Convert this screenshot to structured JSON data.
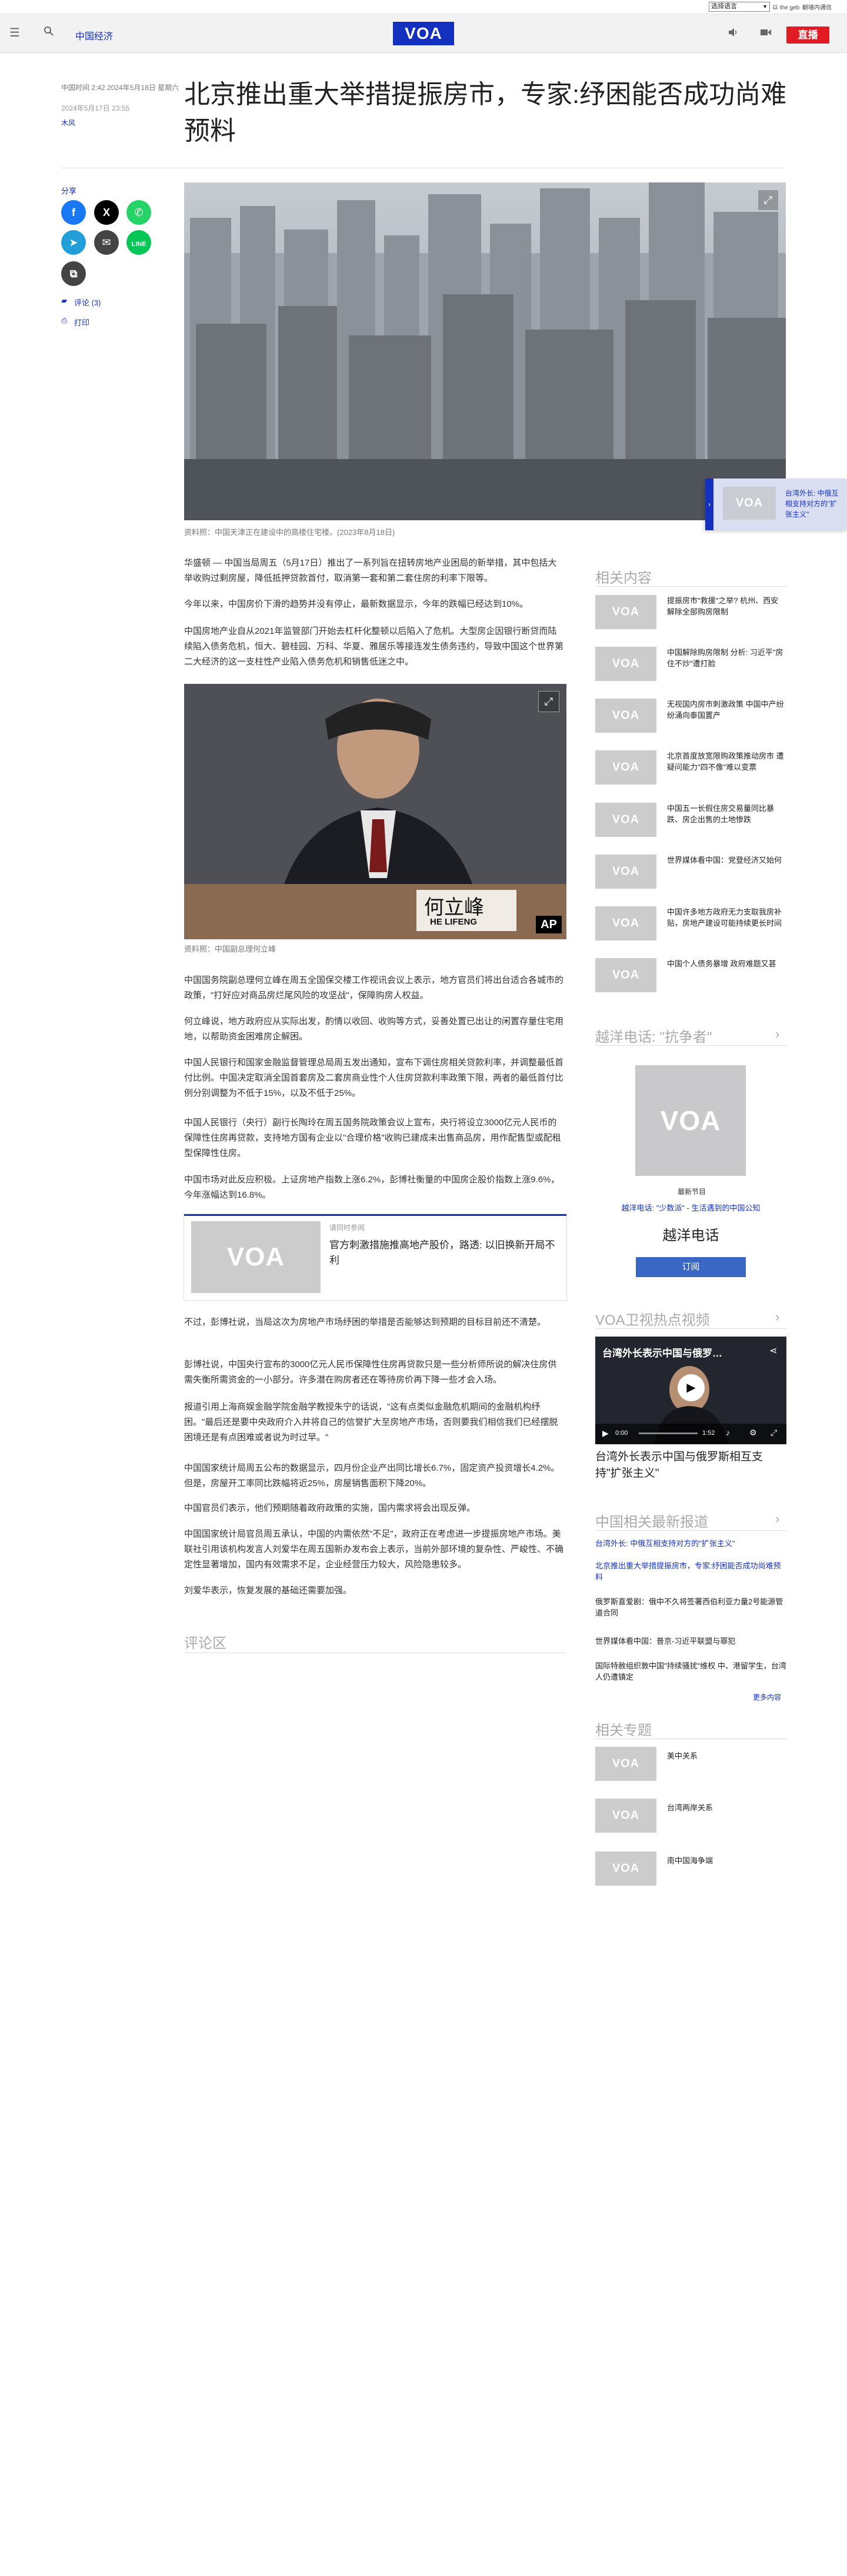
{
  "utility": {
    "lang_select": "选择语言",
    "link1": "以 the geb",
    "link2": "翻墙内通信"
  },
  "header": {
    "section": "中国经济",
    "logo": "VOA",
    "live": "直播"
  },
  "article": {
    "dateline": "中国时间 2:42 2024年5月18日 星期六",
    "pubdate": "2024年5月17日 23:55",
    "author": "木风",
    "title": "北京推出重大举措提振房市，专家:纾困能否成功尚难预料",
    "hero_caption": "资料照：中国天津正在建设中的高楼住宅楼。(2023年8月18日)",
    "photo2_caption": "资料照：中国副总理何立峰",
    "photo2_nameplate": "何立峰",
    "photo2_nameplate_en": "HE LIFENG",
    "photo2_badge": "AP",
    "paragraphs": [
      "华盛顿 — 中国当局周五（5月17日）推出了一系列旨在扭转房地产业困局的新举措，其中包括大举收购过剩房屋，降低抵押贷款首付，取消第一套和第二套住房的利率下限等。",
      "今年以来，中国房价下滑的趋势并没有停止，最新数据显示，今年的跌幅已经达到10%。",
      "中国房地产业自从2021年监管部门开始去杠杆化整顿以后陷入了危机。大型房企因银行断贷而陆续陷入债务危机，恒大、碧桂园、万科、华夏、雅居乐等接连发生债务违约，导致中国这个世界第二大经济的这一支柱性产业陷入债务危机和销售低迷之中。",
      "中国国务院副总理何立峰在周五全国保交楼工作视讯会议上表示，地方官员们将出台适合各城市的政策，\"打好应对商品房烂尾风险的攻坚战\"，保障购房人权益。",
      "何立峰说，地方政府应从实际出发，酌情以收回、收购等方式，妥善处置已出让的闲置存量住宅用地，以帮助资金困难房企解困。",
      "中国人民银行和国家金融监督管理总局周五发出通知，宣布下调住房相关贷款利率，并调整最低首付比例。中国决定取消全国首套房及二套房商业性个人住房贷款利率政策下限，两者的最低首付比例分别调整为不低于15%，以及不低于25%。",
      "中国人民银行（央行）副行长陶玲在周五国务院政策会议上宣布，央行将设立3000亿元人民币的保障性住房再贷款，支持地方国有企业以\"合理价格\"收购已建成未出售商品房，用作配售型或配租型保障性住房。",
      "中国市场对此反应积极。上证房地产指数上涨6.2%，彭博社衡量的中国房企股价指数上涨9.6%，今年涨幅达到16.8%。",
      "不过，彭博社说，当局这次为房地产市场纾困的举措是否能够达到预期的目标目前还不清楚。",
      "彭博社说，中国央行宣布的3000亿元人民币保障性住房再贷款只是一些分析师所说的解决住房供需失衡所需资金的一小部分。许多潜在购房者还在等待房价再下降一些才会入场。",
      "报道引用上海商娱金融学院金融学教授朱宁的话说，\"这有点类似金融危机期间的金融机构纾困。\"最后还是要中央政府介入并将自己的信誉扩大至房地产市场，否则要我们相信我们已经摆脱困境还是有点困难或者说为时过早。\"",
      "中国国家统计局周五公布的数据显示，四月份企业产出同比增长6.7%，固定资产投资增长4.2%。但是，房屋开工率同比跌幅将近25%，房屋销售面积下降20%。",
      "中国官员们表示，他们预期随着政府政策的实施，国内需求将会出现反弹。",
      "中国国家统计局官员周五承认，中国的内需依然\"不足\"，政府正在考虑进一步提振房地产市场。美联社引用该机构发言人刘爱华在周五国新办发布会上表示，当前外部环境的复杂性、严峻性、不确定性显著增加，国内有效需求不足，企业经营压力较大，风险隐患较多。",
      "刘爱华表示，恢复发展的基础还需要加强。"
    ],
    "read_also_label": "请同时参阅",
    "read_also_title": "官方刺激措施推高地产股价，路透: 以旧换新开局不利",
    "comments_heading": "评论区"
  },
  "share": {
    "label": "分享",
    "comments_link": "评论 (3)",
    "print_link": "打印"
  },
  "sidebar": {
    "related_heading": "相关内容",
    "related": [
      "提振房市\"救援\"之举? 杭州、西安解除全部购房限制",
      "中国解除购房限制 分析: 习近平\"房住不炒\"遭打脸",
      "无视国内房市刺激政策 中国中产纷纷涌向泰国置产",
      "北京首度放宽限购政策推动房市 遭疑问能力\"四不像\"难以变票",
      "中国五一长假住房交易量同比暴跌、房企出售的土地惨跌",
      "世界媒体看中国：党登经济又始何",
      "中国许多地方政府无力支取我房补贴，房地产建设可能持续更长时间",
      "中国个人债务暴增 政府难题又甚"
    ],
    "podcast_heading": "越洋电话: \"抗争者\"",
    "podcast_latest": "最新节目",
    "podcast_episode": "越洋电话: \"少数派\" - 生活遇到的中国公知",
    "podcast_name": "越洋电话",
    "podcast_subscribe": "订阅",
    "video_heading": "VOA卫视热点视频",
    "video_title_overlay": "台湾外长表示中国与俄罗…",
    "video_caption": "台湾外长表示中国与俄罗斯相互支持\"扩张主义\"",
    "video_time": "0:00",
    "video_duration": "1:52",
    "china_news_heading": "中国相关最新报道",
    "china_news": [
      "台湾外长: 中俄互相支持对方的\"扩张主义\"",
      "北京推出重大举措提振房市，专家:纾困能否成功尚难预料",
      "俄罗斯喜爱剧：俄中不久将签署西伯利亚力量2号能源管道合同",
      "世界媒体看中国：普京-习近平联盟与罪犯",
      "国际特赦组织敦中国\"持续骚扰\"维权 中、港留学生，台湾人仍遭镇定"
    ],
    "more": "更多内容",
    "topics_heading": "相关专题",
    "topics": [
      "美中关系",
      "台湾两岸关系",
      "南中国海争端"
    ]
  },
  "float_card": {
    "text": "台湾外长: 中俄互相支持对方的\"扩张主义\""
  },
  "colors": {
    "brand_blue": "#1330bf",
    "live_red": "#e31b23"
  }
}
